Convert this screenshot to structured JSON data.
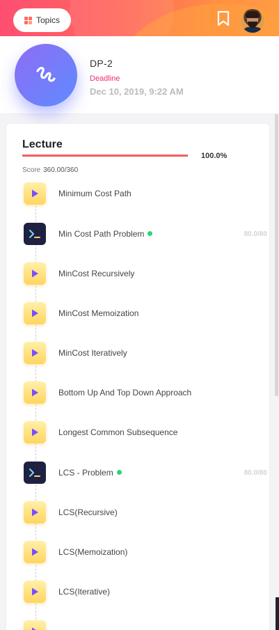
{
  "header": {
    "topics_label": "Topics",
    "icons": [
      "grid-icon",
      "bookmark-icon",
      "avatar"
    ]
  },
  "course": {
    "title": "DP-2",
    "deadline_label": "Deadline",
    "deadline_date": "Dec 10, 2019, 9:22 AM"
  },
  "lecture": {
    "title": "Lecture",
    "progress": 1.0,
    "percent": "100.0%",
    "score_label": "Score",
    "score_value": "360.00/360",
    "items": [
      {
        "type": "video",
        "label": "Minimum Cost Path"
      },
      {
        "type": "code",
        "label": "Min Cost Path Problem",
        "done": true,
        "points": "80.0/80"
      },
      {
        "type": "video",
        "label": "MinCost Recursively"
      },
      {
        "type": "video",
        "label": "MinCost Memoization"
      },
      {
        "type": "video",
        "label": "MinCost Iteratively"
      },
      {
        "type": "video",
        "label": "Bottom Up And Top Down Approach"
      },
      {
        "type": "video",
        "label": "Longest Common Subsequence"
      },
      {
        "type": "code",
        "label": "LCS - Problem",
        "done": true,
        "points": "80.0/80"
      },
      {
        "type": "video",
        "label": "LCS(Recursive)"
      },
      {
        "type": "video",
        "label": "LCS(Memoization)"
      },
      {
        "type": "video",
        "label": "LCS(Iterative)"
      },
      {
        "type": "video",
        "label": ""
      }
    ]
  },
  "colors": {
    "accent": "#f06060",
    "deadline": "#ec2d72",
    "done_dot": "#2bd56f",
    "video_icon": "#7a4cff"
  }
}
